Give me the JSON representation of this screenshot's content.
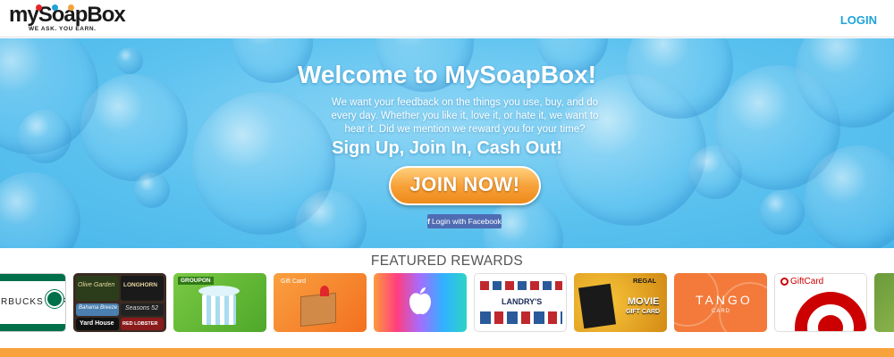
{
  "header": {
    "logo_text": "mySoapBox",
    "logo_tagline": "WE ASK.  YOU EARN.",
    "login_label": "LOGIN"
  },
  "hero": {
    "title": "Welcome to MySoapBox!",
    "text": "We want your feedback on the things you use, buy, and do every day. Whether you like it, love it, or hate it, we want to hear it. Did we mention we reward you for your time?",
    "slogan": "Sign Up, Join In, Cash Out!",
    "join_label": "JOIN NOW!",
    "facebook_label": "Login with Facebook"
  },
  "featured": {
    "title": "FEATURED REWARDS",
    "cards": [
      {
        "brand": "starbucks",
        "label": "RBUCKS CARD"
      },
      {
        "brand": "darden",
        "labels": [
          "Olive Garden",
          "LONGHORN",
          "Bahama Breeze",
          "Seasons 52",
          "Yard House",
          "RED LOBSTER"
        ]
      },
      {
        "brand": "groupon",
        "label": "GROUPON"
      },
      {
        "brand": "home-depot",
        "label": "Gift Card"
      },
      {
        "brand": "itunes",
        "label": ""
      },
      {
        "brand": "landrys",
        "label": "LANDRY'S"
      },
      {
        "brand": "regal",
        "labels": [
          "REGAL",
          "MOVIE",
          "GIFT CARD"
        ]
      },
      {
        "brand": "tango",
        "labels": [
          "TANGO",
          "CARD"
        ]
      },
      {
        "brand": "target",
        "label": "GiftCard"
      },
      {
        "brand": "misc",
        "label": ""
      }
    ]
  },
  "colors": {
    "accent": "#1ea3d8",
    "hero_blue": "#5cc2ef",
    "join_orange": "#f7a23a",
    "facebook_blue": "#4f6cb3"
  }
}
